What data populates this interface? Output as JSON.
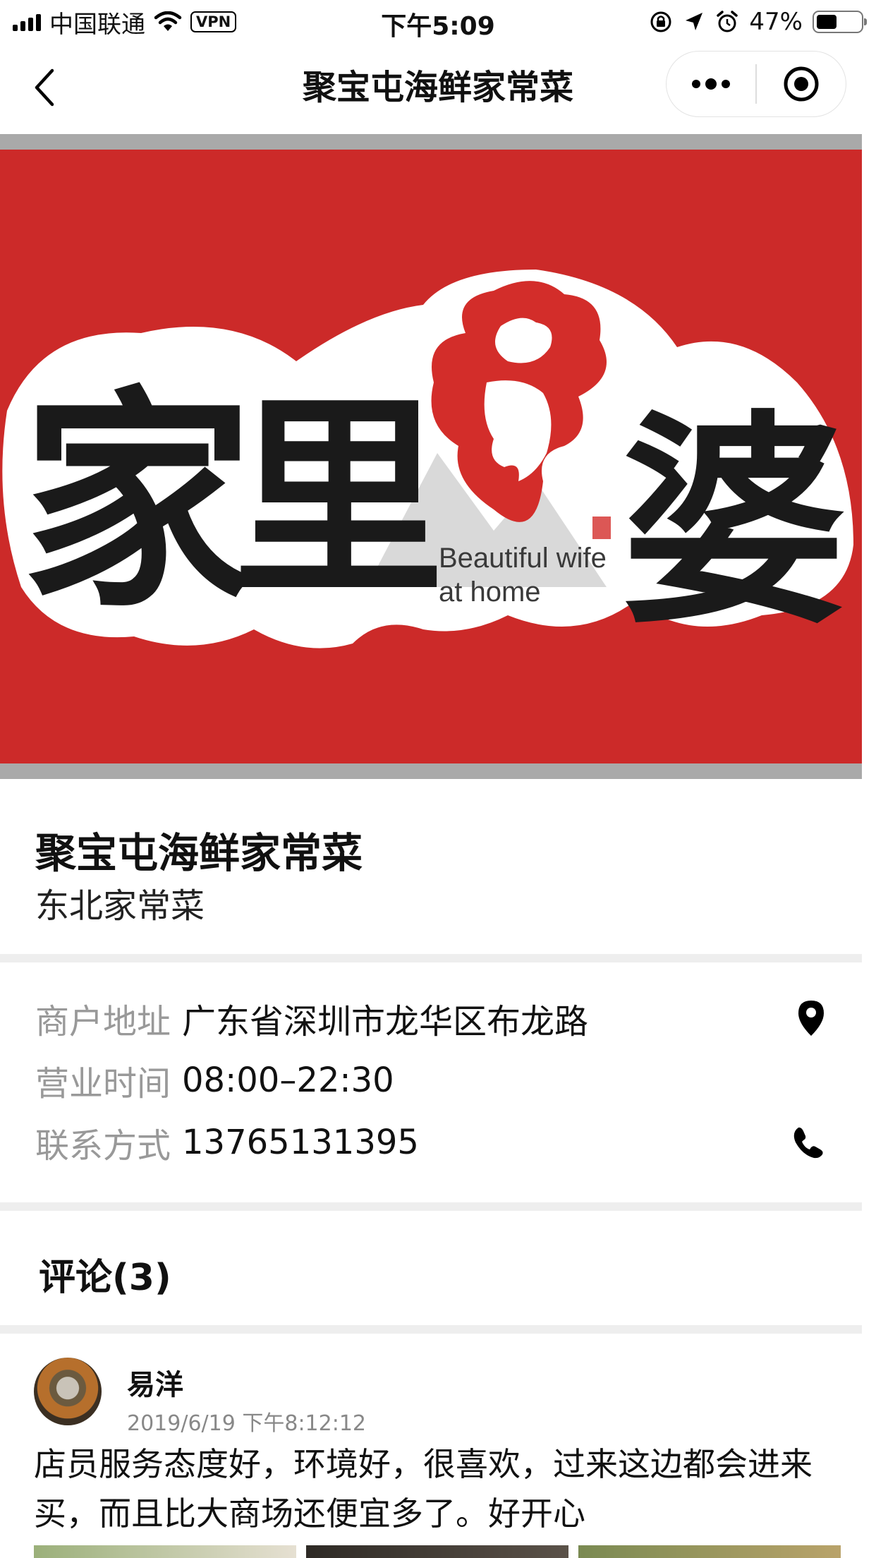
{
  "status_bar": {
    "carrier": "中国联通",
    "vpn": "VPN",
    "time": "下午5:09",
    "battery_percent": "47%",
    "battery_level": 0.47
  },
  "nav": {
    "title": "聚宝屯海鲜家常菜"
  },
  "banner": {
    "logo_chars": [
      "家",
      "里",
      "婆"
    ],
    "english_line1": "Beautiful wife",
    "english_line2": "at home",
    "colors": {
      "background": "#cc2a29",
      "text": "#1a1a1a",
      "outline": "#ffffff"
    }
  },
  "store": {
    "name": "聚宝屯海鲜家常菜",
    "category": "东北家常菜"
  },
  "info": {
    "address_label": "商户地址",
    "address_value": "广东省深圳市龙华区布龙路",
    "hours_label": "营业时间",
    "hours_value": "08:00–22:30",
    "phone_label": "联系方式",
    "phone_value": "13765131395",
    "icons": {
      "address": "location-pin-icon",
      "phone": "phone-icon"
    }
  },
  "reviews": {
    "title": "评论(3)",
    "items": [
      {
        "name": "易洋",
        "time": "2019/6/19 下午8:12:12",
        "text": "店员服务态度好，环境好，很喜欢，过来这边都会进来买，而且比大商场还便宜多了。好开心"
      }
    ]
  }
}
